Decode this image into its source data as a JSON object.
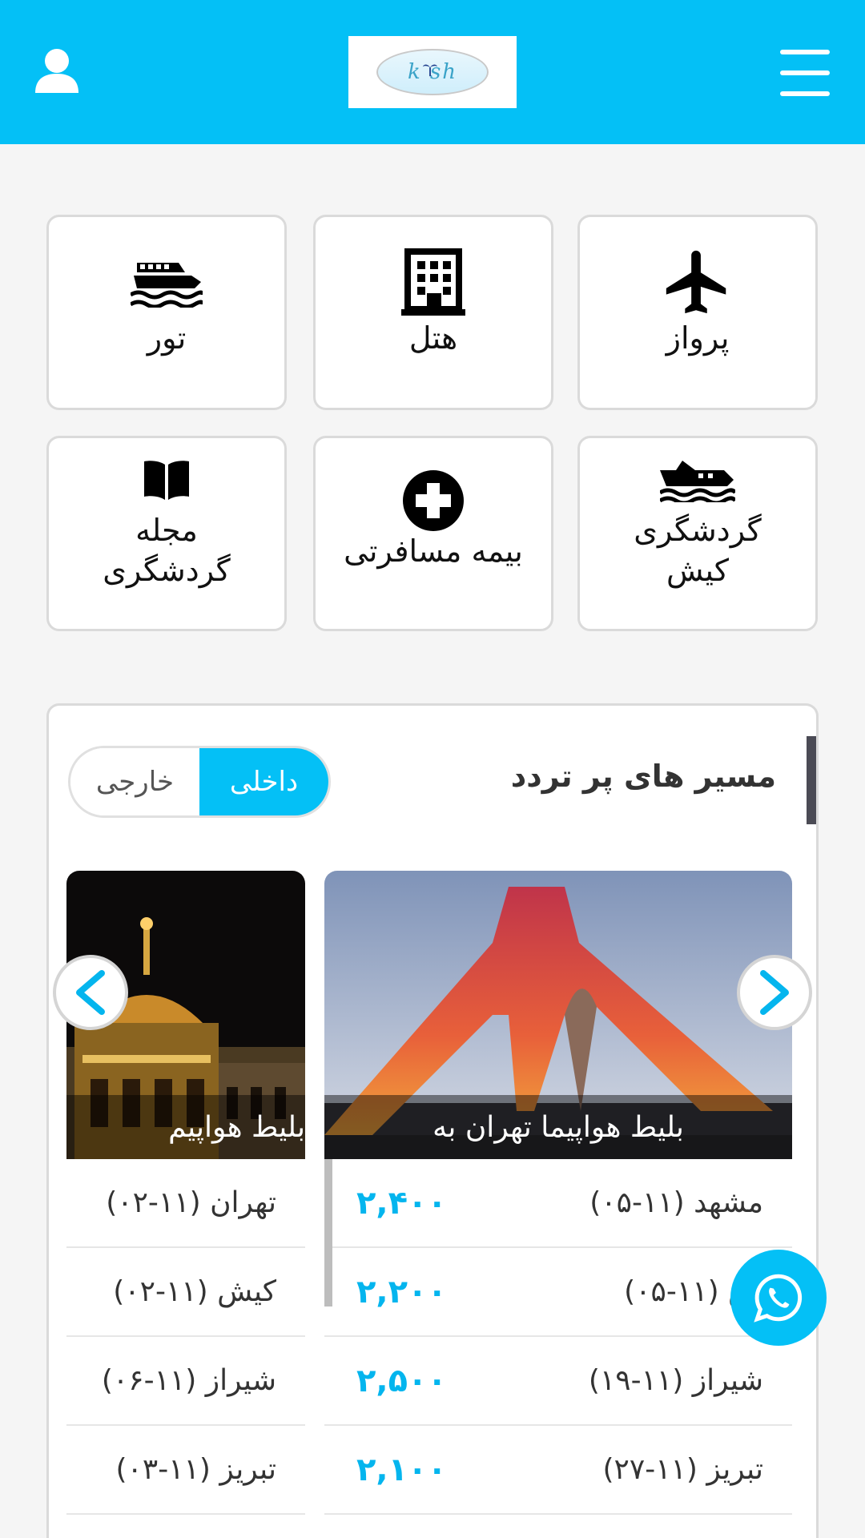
{
  "header": {
    "logo_text": "k  sh",
    "brand_color": "#04c0f6"
  },
  "services": [
    {
      "label": "پرواز",
      "icon": "airplane-icon"
    },
    {
      "label": "هتل",
      "icon": "hotel-building-icon"
    },
    {
      "label": "تور",
      "icon": "ship-icon"
    },
    {
      "label": "گردشگری کیش",
      "icon": "boat-icon"
    },
    {
      "label": "بیمه مسافرتی",
      "icon": "plus-circle-icon"
    },
    {
      "label": "مجله گردشگری",
      "icon": "book-icon"
    }
  ],
  "routes_section": {
    "title": "مسیر های پر تردد",
    "toggle": {
      "domestic": "داخلی",
      "foreign": "خارجی",
      "selected": "domestic"
    }
  },
  "route_cards": [
    {
      "caption": "بلیط هواپیما تهران به",
      "rows": [
        {
          "name": "مشهد (۱۱-۰۵)",
          "price": "۲,۴۰۰"
        },
        {
          "name": "ش (۱۱-۰۵)",
          "price": "۲,۲۰۰"
        },
        {
          "name": "شیراز (۱۱-۱۹)",
          "price": "۲,۵۰۰"
        },
        {
          "name": "تبریز (۱۱-۲۷)",
          "price": "۲,۱۰۰"
        }
      ]
    },
    {
      "caption": "بلیط هواپیم",
      "rows": [
        {
          "name": "تهران (۱۱-۰۲)"
        },
        {
          "name": "کیش (۱۱-۰۲)"
        },
        {
          "name": "شیراز (۱۱-۰۶)"
        },
        {
          "name": "تبریز (۱۱-۰۳)"
        }
      ]
    }
  ]
}
